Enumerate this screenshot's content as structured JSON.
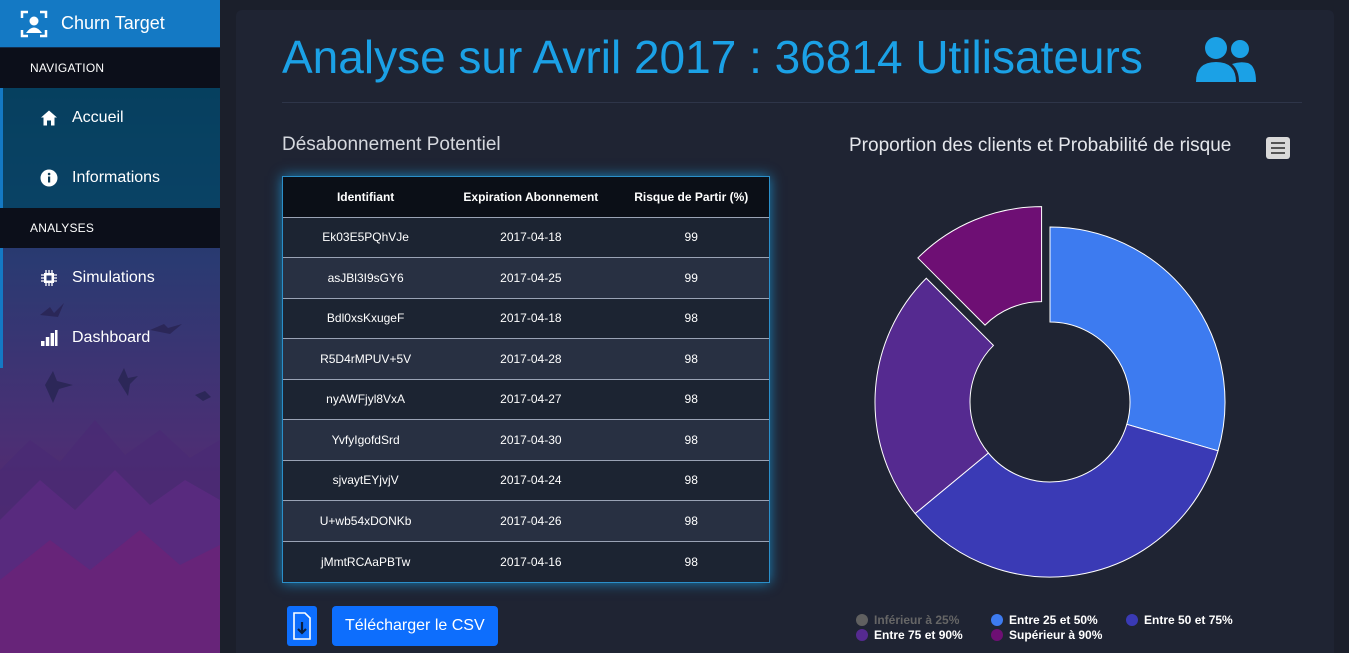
{
  "app": {
    "title": "Churn Target"
  },
  "sidebar": {
    "sections": [
      {
        "header": "NAVIGATION",
        "items": [
          {
            "label": "Accueil",
            "icon": "home-icon"
          },
          {
            "label": "Informations",
            "icon": "info-icon"
          }
        ]
      },
      {
        "header": "ANALYSES",
        "items": [
          {
            "label": "Simulations",
            "icon": "chip-icon"
          },
          {
            "label": "Dashboard",
            "icon": "bar-chart-icon"
          }
        ]
      }
    ]
  },
  "main": {
    "title": "Analyse sur Avril 2017 : 36814 Utilisateurs",
    "title_icon": "users-icon",
    "accent_color": "#1ba1e6"
  },
  "table": {
    "heading": "Désabonnement Potentiel",
    "columns": [
      "Identifiant",
      "Expiration Abonnement",
      "Risque de Partir (%)"
    ],
    "rows": [
      [
        "Ek03E5PQhVJe",
        "2017-04-18",
        "99"
      ],
      [
        "asJBl3I9sGY6",
        "2017-04-25",
        "99"
      ],
      [
        "Bdl0xsKxugeF",
        "2017-04-18",
        "98"
      ],
      [
        "R5D4rMPUV+5V",
        "2017-04-28",
        "98"
      ],
      [
        "nyAWFjyl8VxA",
        "2017-04-27",
        "98"
      ],
      [
        "YvfyIgofdSrd",
        "2017-04-30",
        "98"
      ],
      [
        "sjvaytEYjvjV",
        "2017-04-24",
        "98"
      ],
      [
        "U+wb54xDONKb",
        "2017-04-26",
        "98"
      ],
      [
        "jMmtRCAaPBTw",
        "2017-04-16",
        "98"
      ]
    ],
    "download_label": "Télécharger le CSV"
  },
  "chart_data": {
    "type": "pie",
    "title": "Proportion des clients et Probabilité de risque",
    "series": [
      {
        "name": "Inférieur à 25%",
        "value": 0,
        "color": "#606060",
        "visible": false
      },
      {
        "name": "Entre 25 et 50%",
        "value": 29.5,
        "color": "#3d7bf0",
        "visible": true
      },
      {
        "name": "Entre 50 et 75%",
        "value": 34.5,
        "color": "#3a3ab5",
        "visible": true
      },
      {
        "name": "Entre 75 et 90%",
        "value": 23.5,
        "color": "#552a90",
        "visible": true
      },
      {
        "name": "Supérieur à 90%",
        "value": 12.5,
        "color": "#6e0f74",
        "visible": true
      }
    ],
    "legend_position": "bottom",
    "hole": true
  }
}
